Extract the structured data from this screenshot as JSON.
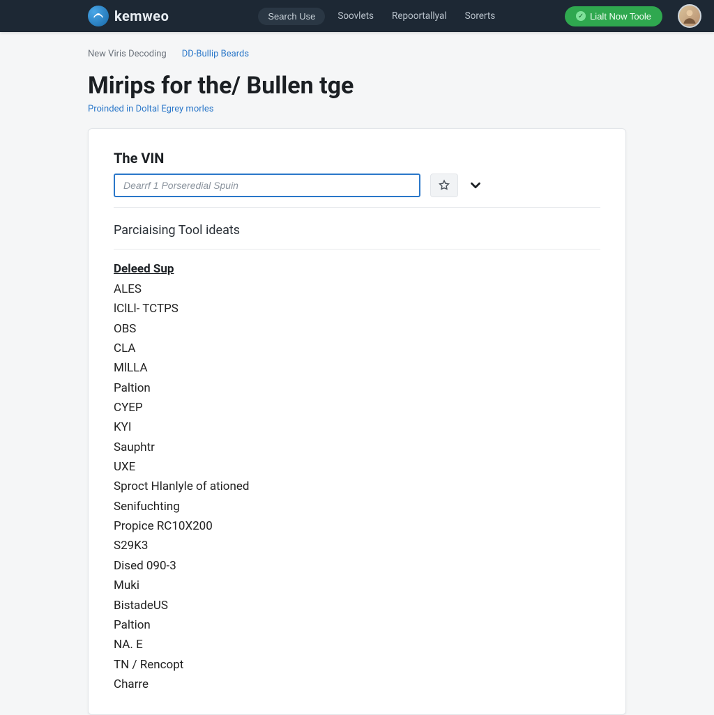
{
  "brand": {
    "name": "kemweo"
  },
  "nav": {
    "search_label": "Search Use",
    "links": [
      "Soovlets",
      "Repoortallyal",
      "Sorerts"
    ],
    "cta_label": "Lialt Now Toole"
  },
  "breadcrumbs": {
    "muted": "New Viris Decoding",
    "link": "DD-Bullip Beards"
  },
  "page": {
    "title": "Mirips for the/ Bullen tge",
    "subtitle": "Proinded in Doltal Egrey morles"
  },
  "vin": {
    "section_label": "The VIN",
    "placeholder": "Dearrf 1 Porseredial Spuin"
  },
  "tool": {
    "heading": "Parciaising Tool ideats"
  },
  "list": {
    "heading": "Deleed Sup",
    "items": [
      "ALES",
      "lClLl- TCTPS",
      "OBS",
      "CLA",
      "MlLLA",
      "Paltion",
      "CYEP",
      "KYI",
      "Sauphtr",
      "UXE",
      "Sproct Hlanlyle of ationed",
      "Senifuchting",
      "Propice RC10X200",
      "S29K3",
      "Dised 090-3",
      "Muki",
      "BistadeUS",
      "Paltion",
      "NA. E",
      "TN / Rencopt",
      "Charre"
    ]
  }
}
